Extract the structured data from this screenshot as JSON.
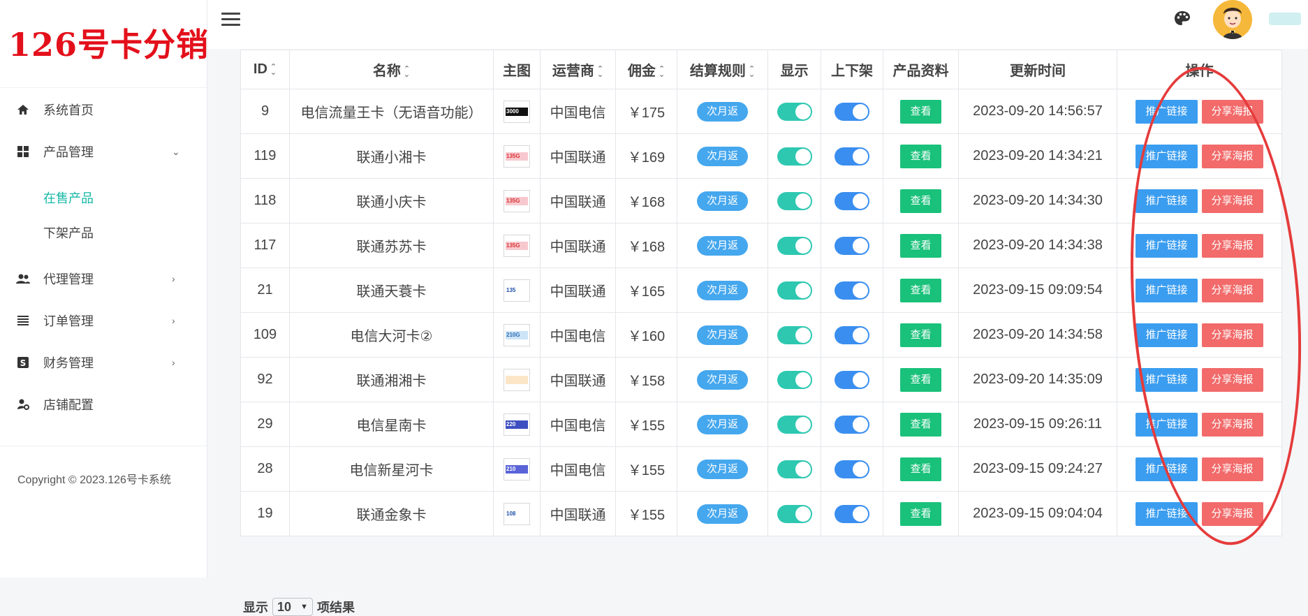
{
  "brand": {
    "title": "126号卡分销"
  },
  "sidebar": {
    "items": [
      {
        "label": "系统首页",
        "icon": "home-icon"
      },
      {
        "label": "产品管理",
        "icon": "grid-icon",
        "chevron": "expanded"
      },
      {
        "label": "代理管理",
        "icon": "users-icon",
        "chevron": "collapsed"
      },
      {
        "label": "订单管理",
        "icon": "list-icon",
        "chevron": "collapsed"
      },
      {
        "label": "财务管理",
        "icon": "finance-icon",
        "chevron": "collapsed"
      },
      {
        "label": "店铺配置",
        "icon": "settings-user-icon"
      }
    ],
    "subitems": [
      {
        "label": "在售产品",
        "active": true
      },
      {
        "label": "下架产品",
        "active": false
      }
    ],
    "copyright": "Copyright © 2023.126号卡系统"
  },
  "table": {
    "headers": [
      "ID",
      "名称",
      "主图",
      "运营商",
      "佣金",
      "结算规则",
      "显示",
      "上下架",
      "产品资料",
      "更新时间",
      "操作"
    ],
    "rows": [
      {
        "id": "9",
        "name": "电信流量王卡（无语音功能）",
        "thumb": "3000",
        "carrier": "中国电信",
        "commission": "￥175",
        "rule": "次月返",
        "show": true,
        "listed": true,
        "view": "查看",
        "updated": "2023-09-20 14:56:57",
        "link": "推广链接",
        "poster": "分享海报"
      },
      {
        "id": "119",
        "name": "联通小湘卡",
        "thumb": "135G",
        "carrier": "中国联通",
        "commission": "￥169",
        "rule": "次月返",
        "show": true,
        "listed": true,
        "view": "查看",
        "updated": "2023-09-20 14:34:21",
        "link": "推广链接",
        "poster": "分享海报"
      },
      {
        "id": "118",
        "name": "联通小庆卡",
        "thumb": "135G",
        "carrier": "中国联通",
        "commission": "￥168",
        "rule": "次月返",
        "show": true,
        "listed": true,
        "view": "查看",
        "updated": "2023-09-20 14:34:30",
        "link": "推广链接",
        "poster": "分享海报"
      },
      {
        "id": "117",
        "name": "联通苏苏卡",
        "thumb": "135G",
        "carrier": "中国联通",
        "commission": "￥168",
        "rule": "次月返",
        "show": true,
        "listed": true,
        "view": "查看",
        "updated": "2023-09-20 14:34:38",
        "link": "推广链接",
        "poster": "分享海报"
      },
      {
        "id": "21",
        "name": "联通天蓑卡",
        "thumb": "135",
        "carrier": "中国联通",
        "commission": "￥165",
        "rule": "次月返",
        "show": true,
        "listed": true,
        "view": "查看",
        "updated": "2023-09-15 09:09:54",
        "link": "推广链接",
        "poster": "分享海报"
      },
      {
        "id": "109",
        "name": "电信大河卡②",
        "thumb": "210G",
        "carrier": "中国电信",
        "commission": "￥160",
        "rule": "次月返",
        "show": true,
        "listed": true,
        "view": "查看",
        "updated": "2023-09-20 14:34:58",
        "link": "推广链接",
        "poster": "分享海报"
      },
      {
        "id": "92",
        "name": "联通湘湘卡",
        "thumb": "",
        "carrier": "中国联通",
        "commission": "￥158",
        "rule": "次月返",
        "show": true,
        "listed": true,
        "view": "查看",
        "updated": "2023-09-20 14:35:09",
        "link": "推广链接",
        "poster": "分享海报"
      },
      {
        "id": "29",
        "name": "电信星南卡",
        "thumb": "220",
        "carrier": "中国电信",
        "commission": "￥155",
        "rule": "次月返",
        "show": true,
        "listed": true,
        "view": "查看",
        "updated": "2023-09-15 09:26:11",
        "link": "推广链接",
        "poster": "分享海报"
      },
      {
        "id": "28",
        "name": "电信新星河卡",
        "thumb": "210",
        "carrier": "中国电信",
        "commission": "￥155",
        "rule": "次月返",
        "show": true,
        "listed": true,
        "view": "查看",
        "updated": "2023-09-15 09:24:27",
        "link": "推广链接",
        "poster": "分享海报"
      },
      {
        "id": "19",
        "name": "联通金象卡",
        "thumb": "108",
        "carrier": "中国联通",
        "commission": "￥155",
        "rule": "次月返",
        "show": true,
        "listed": true,
        "view": "查看",
        "updated": "2023-09-15 09:04:04",
        "link": "推广链接",
        "poster": "分享海报"
      }
    ]
  },
  "pagination": {
    "prefix": "显示",
    "value": "10",
    "suffix": "项结果"
  },
  "colors": {
    "brand_red": "#e3101b",
    "active_teal": "#14b8a6",
    "switch_teal": "#2ec8b1",
    "switch_blue": "#3a8ef0",
    "view_green": "#19c17a",
    "link_blue": "#3a9df0",
    "poster_red": "#f26a6a",
    "annotation_red": "#e53b3b"
  }
}
